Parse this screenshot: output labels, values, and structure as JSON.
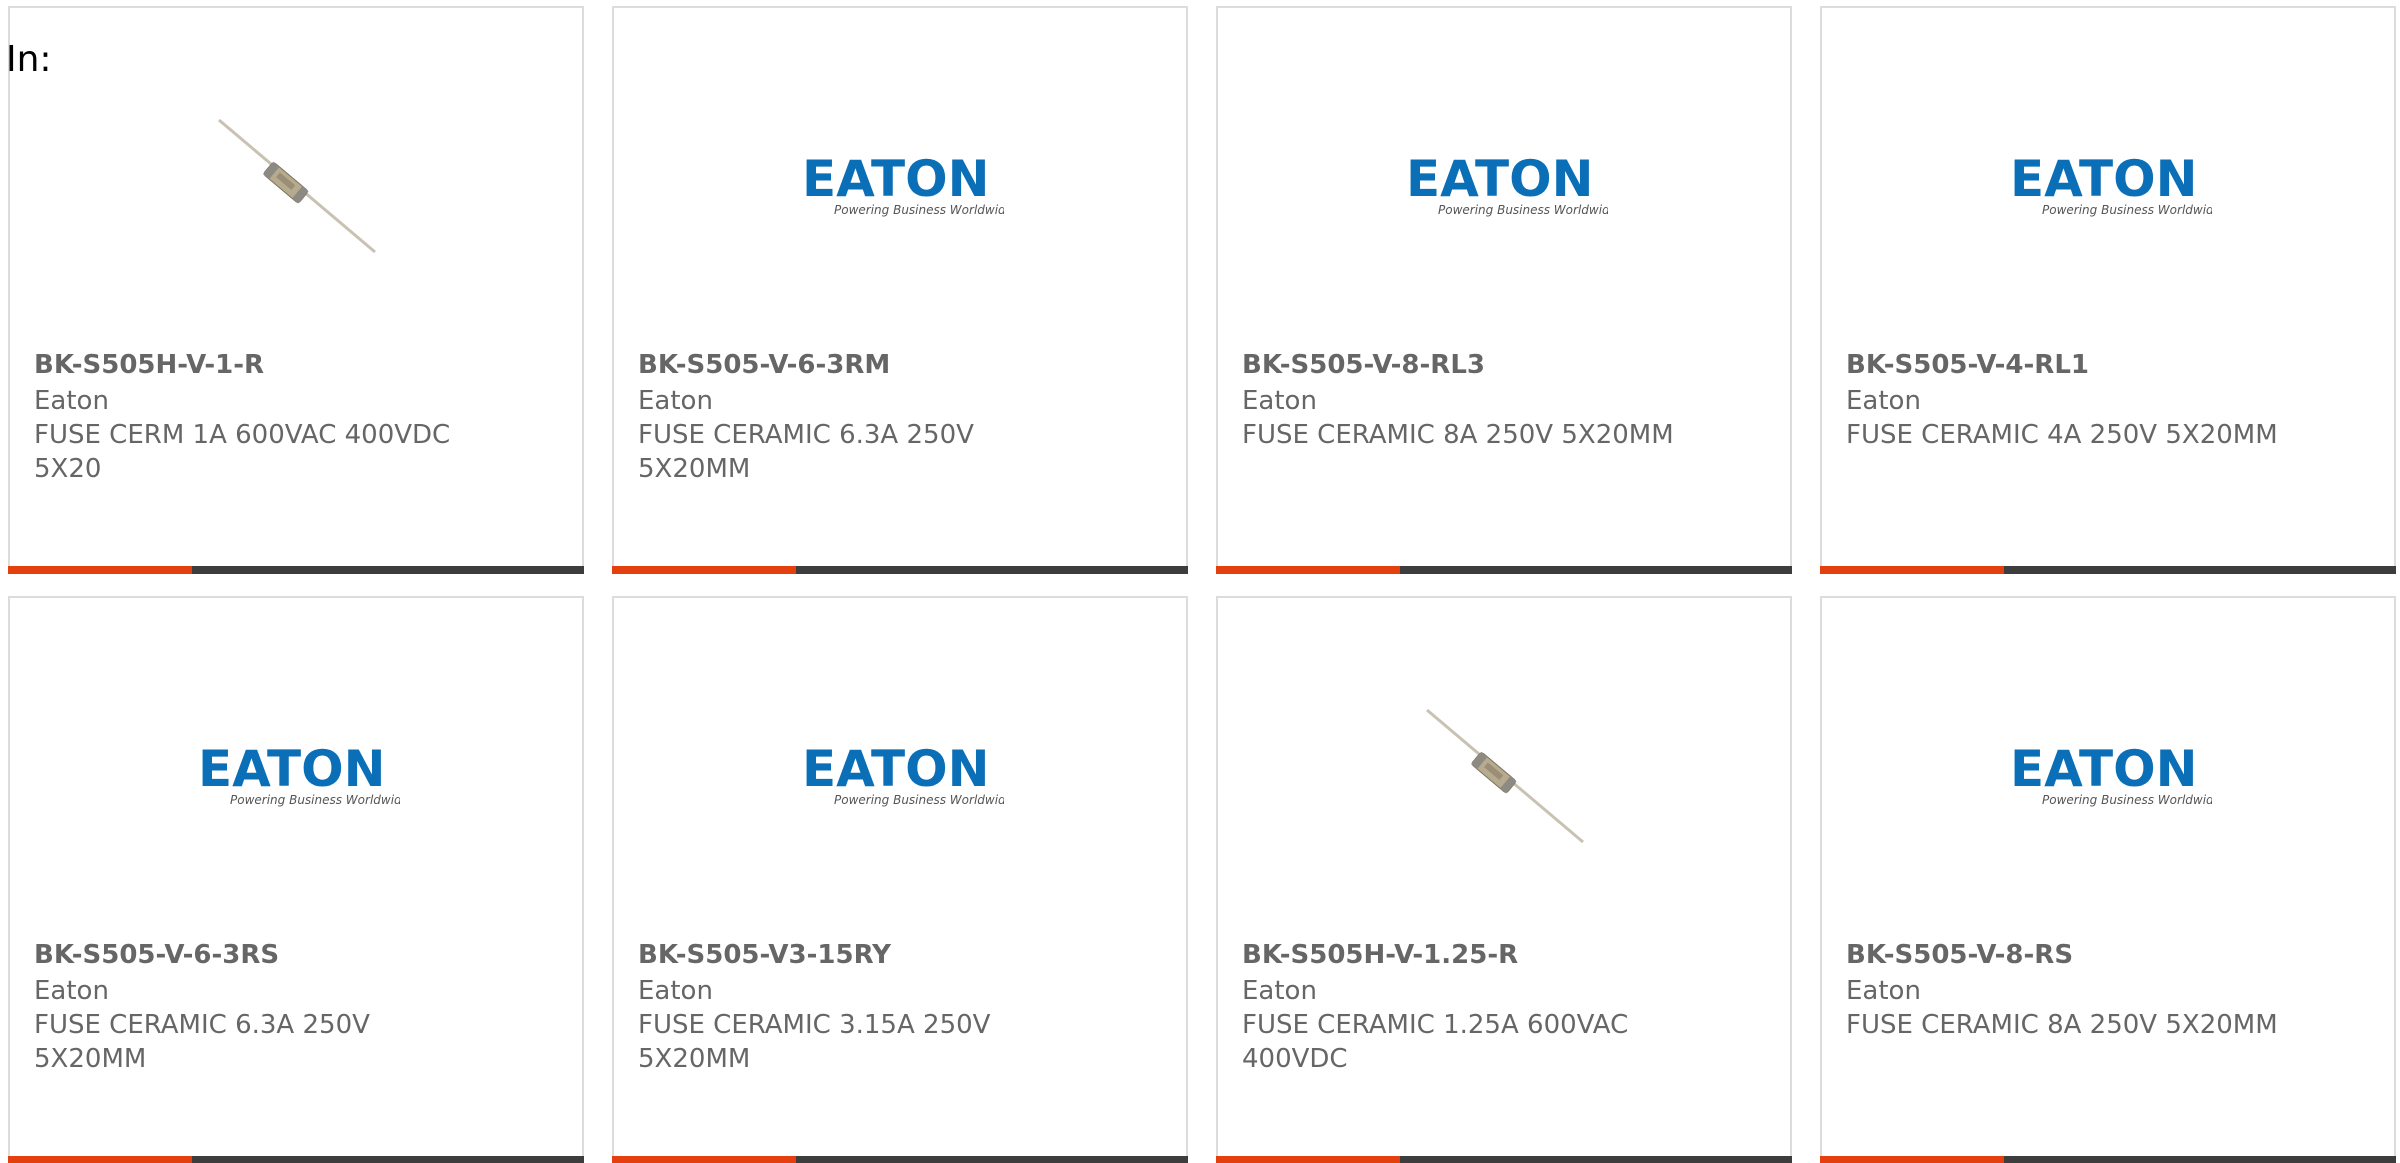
{
  "header": {
    "in_label": "In:"
  },
  "colors": {
    "accent": "#e43f0f",
    "bar": "#3d3d3d",
    "text": "#666666",
    "eaton_blue": "#0b6fb8"
  },
  "logo": {
    "wordmark": "EATON",
    "tagline": "Powering Business Worldwide"
  },
  "products": [
    {
      "part": "BK-S505H-V-1-R",
      "brand": "Eaton",
      "desc": "FUSE CERM 1A 600VAC 400VDC 5X20",
      "image": "fuse-photo"
    },
    {
      "part": "BK-S505-V-6-3RM",
      "brand": "Eaton",
      "desc": "FUSE CERAMIC 6.3A 250V 5X20MM",
      "image": "eaton-logo"
    },
    {
      "part": "BK-S505-V-8-RL3",
      "brand": "Eaton",
      "desc": "FUSE CERAMIC 8A 250V 5X20MM",
      "image": "eaton-logo"
    },
    {
      "part": "BK-S505-V-4-RL1",
      "brand": "Eaton",
      "desc": "FUSE CERAMIC 4A 250V 5X20MM",
      "image": "eaton-logo"
    },
    {
      "part": "BK-S505-V-6-3RS",
      "brand": "Eaton",
      "desc": "FUSE CERAMIC 6.3A 250V 5X20MM",
      "image": "eaton-logo"
    },
    {
      "part": "BK-S505-V3-15RY",
      "brand": "Eaton",
      "desc": "FUSE CERAMIC 3.15A 250V 5X20MM",
      "image": "eaton-logo"
    },
    {
      "part": "BK-S505H-V-1.25-R",
      "brand": "Eaton",
      "desc": "FUSE CERAMIC 1.25A 600VAC 400VDC",
      "image": "fuse-photo"
    },
    {
      "part": "BK-S505-V-8-RS",
      "brand": "Eaton",
      "desc": "FUSE CERAMIC 8A 250V 5X20MM",
      "image": "eaton-logo"
    }
  ]
}
